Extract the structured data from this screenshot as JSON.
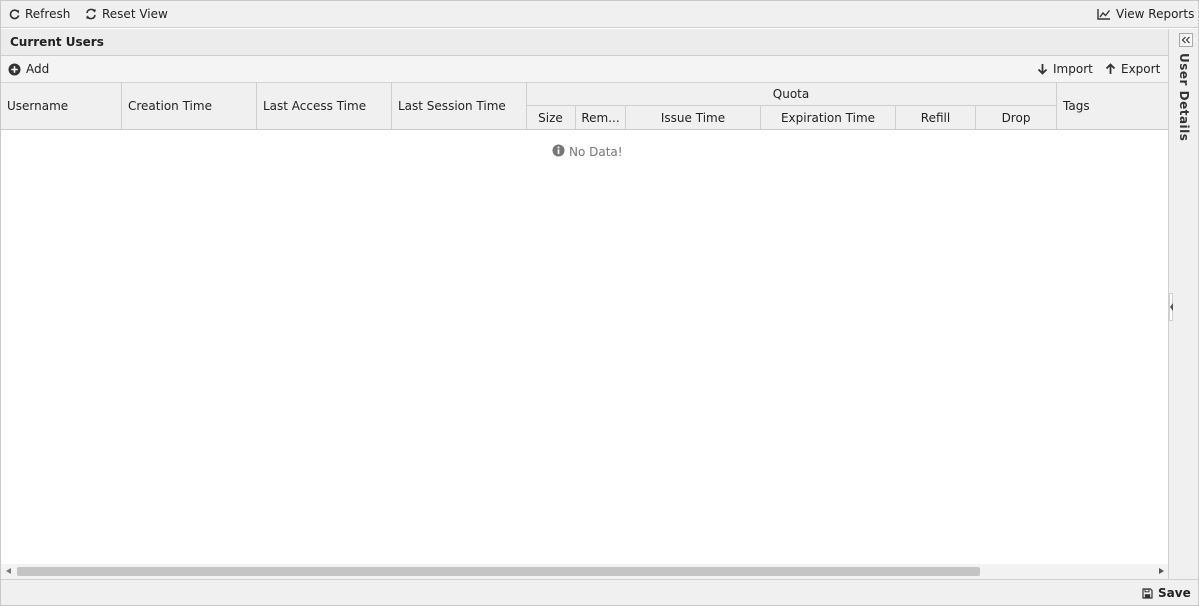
{
  "toolbar": {
    "refresh_label": "Refresh",
    "reset_view_label": "Reset View",
    "view_reports_label": "View Reports"
  },
  "panel": {
    "title": "Current Users"
  },
  "subtoolbar": {
    "add_label": "Add",
    "import_label": "Import",
    "export_label": "Export"
  },
  "grid": {
    "columns": {
      "username": "Username",
      "creation_time": "Creation Time",
      "last_access_time": "Last Access Time",
      "last_session_time": "Last Session Time",
      "tags": "Tags"
    },
    "quota": {
      "title": "Quota",
      "size": "Size",
      "remaining": "Rem...",
      "issue_time": "Issue Time",
      "expiration_time": "Expiration Time",
      "refill": "Refill",
      "drop": "Drop"
    },
    "empty_text": "No Data!"
  },
  "side_panel": {
    "title": "User Details"
  },
  "footer": {
    "save_label": "Save"
  },
  "icons": {
    "refresh": "refresh-icon",
    "reset_view": "sync-icon",
    "view_reports": "line-chart-icon",
    "add": "plus-circle-icon",
    "import": "arrow-down-icon",
    "export": "arrow-up-icon",
    "info": "info-circle-icon",
    "save": "floppy-disk-icon",
    "collapse": "double-chevron-left-icon"
  }
}
